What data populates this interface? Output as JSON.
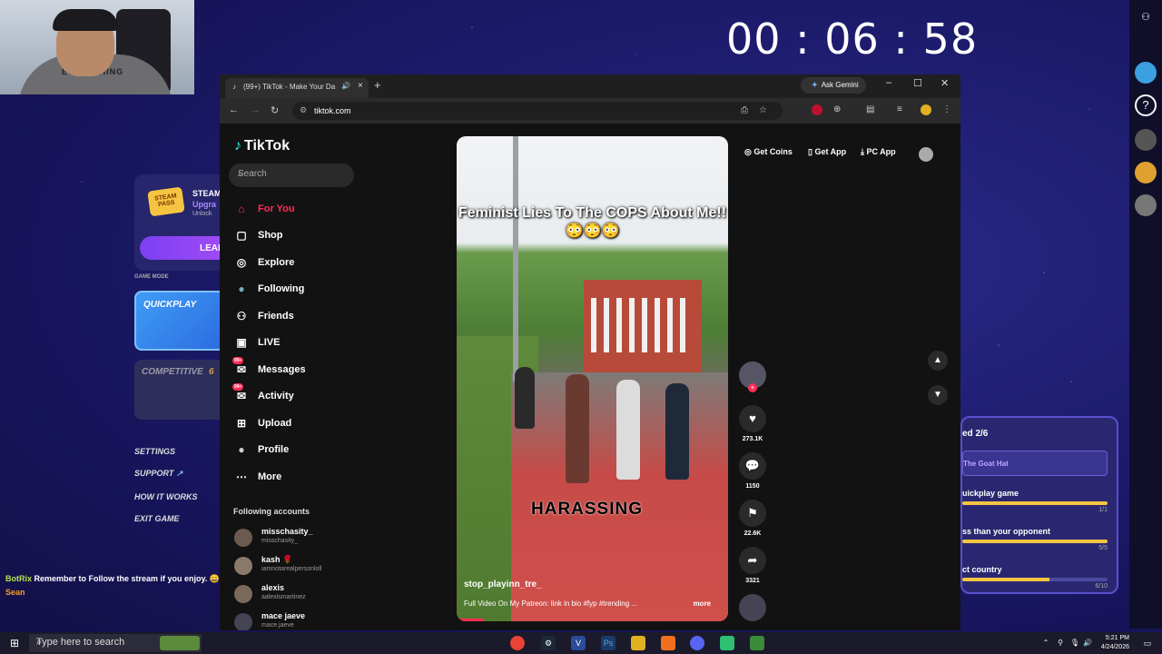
{
  "timer": "00 : 06 : 58",
  "webcam": {
    "shirt_text": "EVERYTHING"
  },
  "game_panel": {
    "steam_title": "STEAM",
    "steam_upgrade": "Upgra",
    "steam_unlock": "Unlock",
    "steam_badge": "STEAM PASS",
    "learn_label": "LEAR",
    "game_mode_label": "GAME MODE",
    "quickplay_label": "QUICKPLAY",
    "competitive_label": "COMPETITIVE",
    "competitive_count": "6",
    "settings": "SETTINGS",
    "support": "SUPPORT",
    "how_it_works": "HOW IT WORKS",
    "exit_game": "EXIT GAME"
  },
  "chat": [
    {
      "user": "BotRix",
      "message": "Remember to Follow the stream if you enjoy. 😄",
      "user_color": "#b6e24a"
    },
    {
      "user": "Sean",
      "message": "",
      "user_color": "#f0a030"
    }
  ],
  "quest_panel": {
    "title": "ed 2/6",
    "reward": "The Goat Hat",
    "rows": [
      {
        "label": "uickplay game",
        "count": "1/1",
        "progress": 1.0
      },
      {
        "label": "ss than your opponent",
        "count": "5/5",
        "progress": 1.0
      },
      {
        "label": "ct country",
        "count": "6/10",
        "progress": 0.6
      }
    ]
  },
  "browser": {
    "tab_title": "(99+) TikTok - Make Your Da",
    "new_tab": "+",
    "ask_gemini": "Ask Gemini",
    "url": "tiktok.com",
    "minimize": "–",
    "maximize": "☐",
    "close": "✕"
  },
  "tiktok": {
    "logo": "TikTok",
    "search_placeholder": "Search",
    "menu": [
      {
        "label": "For You",
        "icon": "home-icon",
        "glyph": "⌂",
        "active": true
      },
      {
        "label": "Shop",
        "icon": "shop-bag-icon",
        "glyph": "🛍"
      },
      {
        "label": "Explore",
        "icon": "compass-icon",
        "glyph": "◎"
      },
      {
        "label": "Following",
        "icon": "following-avatar-icon",
        "glyph": "●"
      },
      {
        "label": "Friends",
        "icon": "friends-icon",
        "glyph": "👥"
      },
      {
        "label": "LIVE",
        "icon": "live-icon",
        "glyph": "▣"
      },
      {
        "label": "Messages",
        "icon": "messages-icon",
        "glyph": "✉",
        "badge": "99+"
      },
      {
        "label": "Activity",
        "icon": "activity-icon",
        "glyph": "✉",
        "badge": "99+"
      },
      {
        "label": "Upload",
        "icon": "upload-icon",
        "glyph": "⊞"
      },
      {
        "label": "Profile",
        "icon": "profile-icon",
        "glyph": "●"
      },
      {
        "label": "More",
        "icon": "more-icon",
        "glyph": "⋯"
      }
    ],
    "following_header": "Following accounts",
    "following": [
      {
        "name": "misschasity_",
        "handle": "misschasity_"
      },
      {
        "name": "kash 🌹",
        "handle": "iamnotarealpersonloll"
      },
      {
        "name": "alexis",
        "handle": "aalexismartinez"
      },
      {
        "name": "mace jaeve",
        "handle": "mace.jaeve"
      }
    ],
    "top_actions": {
      "get_coins": "Get Coins",
      "get_app": "Get App",
      "pc_app": "PC App"
    },
    "video": {
      "caption": "Feminist Lies To The COPS About Me!!😳😳😳",
      "overlay_text": "HARASSING",
      "username": "stop_playinn_tre_",
      "description": "Full Video On My Patreon: link in bio #fyp #trending ...",
      "more": "more"
    },
    "stats": {
      "likes": "273.1K",
      "comments": "1150",
      "saves": "22.6K",
      "shares": "3321"
    }
  },
  "taskbar": {
    "search_placeholder": "Type here to search",
    "time": "5:21 PM",
    "date": "4/24/2026"
  }
}
